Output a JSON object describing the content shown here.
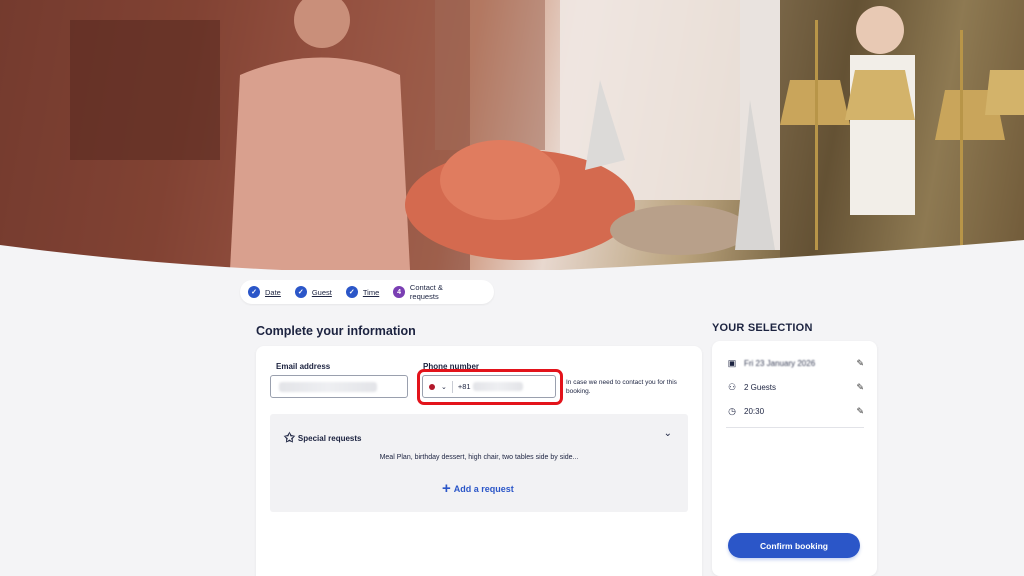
{
  "stepper": {
    "steps": [
      {
        "label": "Date",
        "state": "done"
      },
      {
        "label": "Guest",
        "state": "done"
      },
      {
        "label": "Time",
        "state": "done"
      },
      {
        "label": "Contact & requests",
        "state": "current",
        "number": "4"
      }
    ]
  },
  "form": {
    "title": "Complete your information",
    "email_label": "Email address",
    "phone_label": "Phone number",
    "phone_prefix": "+81",
    "phone_hint": "In case we need to contact you for this booking.",
    "special_requests_title": "Special requests",
    "special_requests_examples": "Meal Plan, birthday dessert, high chair, two tables side by side...",
    "add_request_label": "Add a request"
  },
  "selection": {
    "title": "YOUR SELECTION",
    "date": "Fri 23 January 2026",
    "guests": "2 Guests",
    "time": "20:30",
    "confirm_label": "Confirm booking"
  },
  "colors": {
    "accent": "#2b56c8",
    "current_step": "#7a3fb3",
    "highlight": "#e3131b"
  }
}
